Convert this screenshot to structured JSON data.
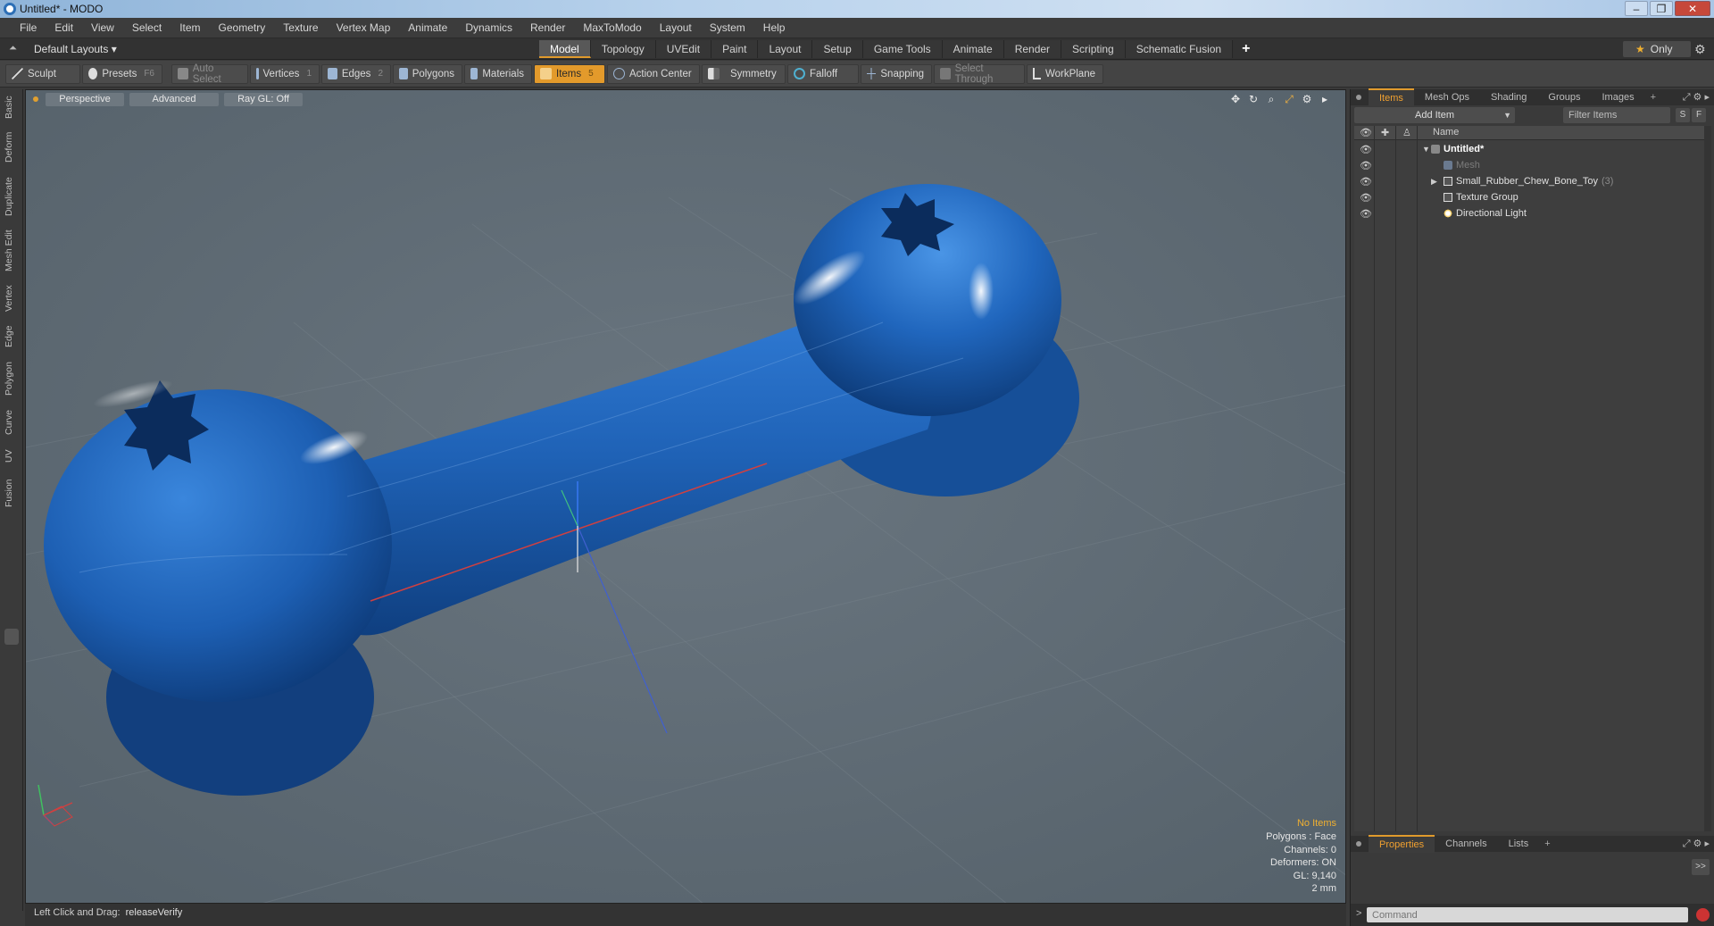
{
  "window": {
    "title": "Untitled* - MODO",
    "controls": {
      "minimize": "–",
      "restore": "❐",
      "close": "✕"
    }
  },
  "menu": [
    "File",
    "Edit",
    "View",
    "Select",
    "Item",
    "Geometry",
    "Texture",
    "Vertex Map",
    "Animate",
    "Dynamics",
    "Render",
    "MaxToModo",
    "Layout",
    "System",
    "Help"
  ],
  "layoutbar": {
    "layout_select": "Default Layouts ▾",
    "tabs": [
      "Model",
      "Topology",
      "UVEdit",
      "Paint",
      "Layout",
      "Setup",
      "Game Tools",
      "Animate",
      "Render",
      "Scripting",
      "Schematic Fusion"
    ],
    "active_tab": "Model",
    "add_tab": "+",
    "only_label": "Only"
  },
  "toolbar": {
    "sculpt": "Sculpt",
    "presets": "Presets",
    "presets_key": "F6",
    "auto_select": "Auto Select",
    "vertices": "Vertices",
    "vertices_key": "1",
    "edges": "Edges",
    "edges_key": "2",
    "polygons": "Polygons",
    "materials": "Materials",
    "items": "Items",
    "items_key": "5",
    "action_center": "Action Center",
    "symmetry": "Symmetry",
    "falloff": "Falloff",
    "snapping": "Snapping",
    "select_through": "Select Through",
    "workplane": "WorkPlane"
  },
  "left_tabs": [
    "Basic",
    "Deform",
    "Duplicate",
    "Mesh Edit",
    "Vertex",
    "Edge",
    "Polygon",
    "Curve",
    "UV",
    "Fusion"
  ],
  "viewport": {
    "view_mode": "Perspective",
    "shading": "Advanced",
    "raygl": "Ray GL: Off",
    "stats": {
      "no_items": "No Items",
      "polygons": "Polygons : Face",
      "channels": "Channels: 0",
      "deformers": "Deformers: ON",
      "gl": "GL: 9,140",
      "unit": "2 mm"
    },
    "colors": {
      "background": "#5e6a73",
      "mesh": "#1e63b8",
      "x_axis": "#d04040",
      "y_axis": "#40c080",
      "z_axis": "#4060d0"
    }
  },
  "statusbar": {
    "hint_label": "Left Click and Drag:",
    "hint_value": "releaseVerify"
  },
  "items_panel": {
    "tabs": [
      "Items",
      "Mesh Ops",
      "Shading",
      "Groups",
      "Images"
    ],
    "active_tab": "Items",
    "add_item": "Add Item",
    "filter_placeholder": "Filter Items",
    "btn_s": "S",
    "btn_f": "F",
    "column_name": "Name",
    "tree": [
      {
        "label": "Untitled*",
        "bold": true
      },
      {
        "label": "Mesh",
        "dim": true
      },
      {
        "label": "Small_Rubber_Chew_Bone_Toy",
        "count": "(3)"
      },
      {
        "label": "Texture Group"
      },
      {
        "label": "Directional Light"
      }
    ]
  },
  "properties_panel": {
    "tabs": [
      "Properties",
      "Channels",
      "Lists"
    ],
    "active_tab": "Properties",
    "expand": ">>"
  },
  "command": {
    "prompt": ">",
    "placeholder": "Command"
  }
}
